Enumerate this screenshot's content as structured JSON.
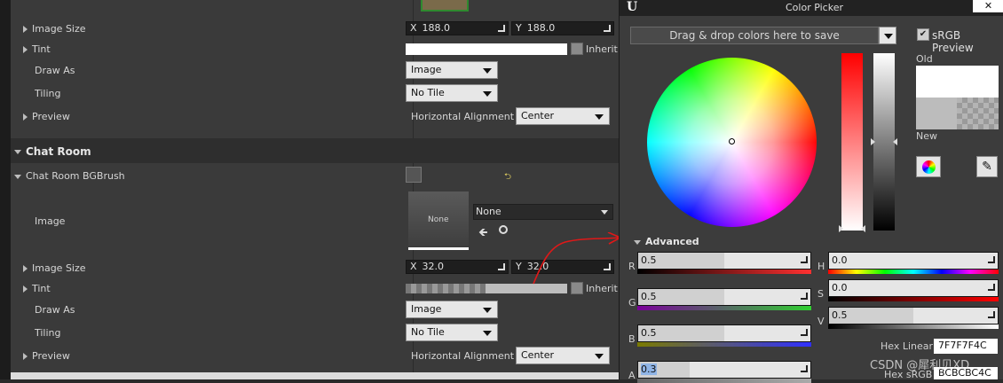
{
  "details": {
    "top_group": {
      "image_size_label": "Image Size",
      "x_label": "X",
      "x_value": "188.0",
      "y_label": "Y",
      "y_value": "188.0",
      "tint_label": "Tint",
      "inherit_label": "Inherit",
      "draw_as_label": "Draw As",
      "draw_as_value": "Image",
      "tiling_label": "Tiling",
      "tiling_value": "No Tile",
      "preview_label": "Preview",
      "halign_label": "Horizontal Alignment",
      "halign_value": "Center"
    },
    "category_title": "Chat Room",
    "brush_label": "Chat Room BGBrush",
    "bottom_group": {
      "image_label": "Image",
      "thumb_text": "None",
      "asset_value": "None",
      "image_size_label": "Image Size",
      "x_label": "X",
      "x_value": "32.0",
      "y_label": "Y",
      "y_value": "32.0",
      "tint_label": "Tint",
      "inherit_label": "Inherit",
      "draw_as_label": "Draw As",
      "draw_as_value": "Image",
      "tiling_label": "Tiling",
      "tiling_value": "No Tile",
      "preview_label": "Preview",
      "halign_label": "Horizontal Alignment",
      "halign_value": "Center"
    }
  },
  "picker": {
    "logo": "U",
    "title": "Color Picker",
    "close_label": "✕",
    "save_bar_placeholder": "Drag & drop colors here to save",
    "srgb_preview_label": "sRGB Preview",
    "old_label": "Old",
    "new_label": "New",
    "advanced_label": "Advanced",
    "channels": [
      {
        "label": "R",
        "value": "0.5",
        "fraction": 0.5,
        "gradient": "linear-gradient(to right,#000,#ff3030)"
      },
      {
        "label": "G",
        "value": "0.5",
        "fraction": 0.5,
        "gradient": "linear-gradient(to right,#7a009a,#30d030)"
      },
      {
        "label": "B",
        "value": "0.5",
        "fraction": 0.5,
        "gradient": "linear-gradient(to right,#7a7a00,#3030ff)"
      },
      {
        "label": "A",
        "value": "0.3",
        "fraction": 0.3,
        "gradient": "linear-gradient(to right,#666,#aaa)"
      }
    ],
    "hsv": [
      {
        "label": "H",
        "value": "0.0",
        "fraction": 0.0,
        "gradient": "linear-gradient(to right,#f00,#ff0,#0f0,#0ff,#00f,#f0f,#f00)"
      },
      {
        "label": "S",
        "value": "0.0",
        "fraction": 0.0,
        "gradient": "linear-gradient(to right,#000,#f00)"
      },
      {
        "label": "V",
        "value": "0.5",
        "fraction": 0.5,
        "gradient": "linear-gradient(to right,#000,#fff)"
      }
    ],
    "hex_linear_label": "Hex Linear",
    "hex_linear_value": "7F7F7F4C",
    "hex_srgb_label": "Hex sRGB",
    "hex_srgb_value": "BCBCBC4C"
  },
  "watermark": "CSDN @犀利贝XD",
  "colors": {
    "accent": "#30d030",
    "arrow": "#e01818"
  }
}
